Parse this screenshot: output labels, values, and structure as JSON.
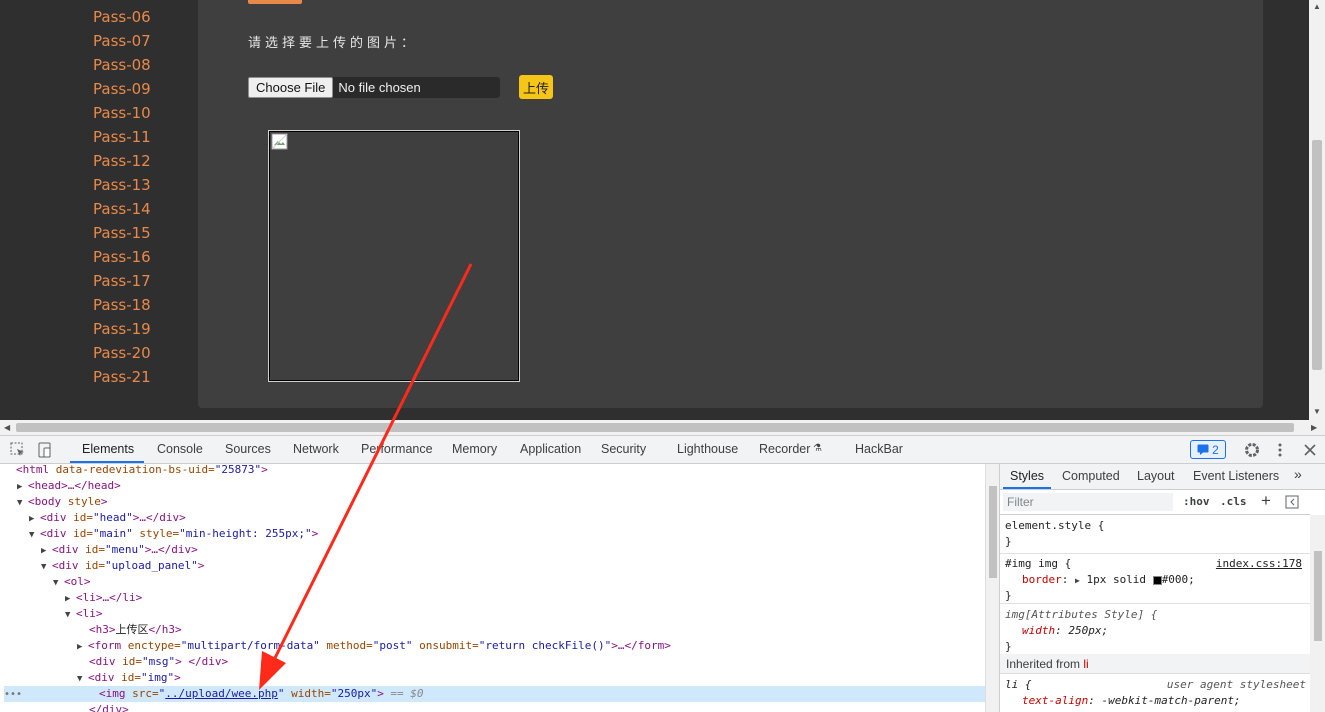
{
  "sidebar": {
    "pass_items": [
      "Pass-06",
      "Pass-07",
      "Pass-08",
      "Pass-09",
      "Pass-10",
      "Pass-11",
      "Pass-12",
      "Pass-13",
      "Pass-14",
      "Pass-15",
      "Pass-16",
      "Pass-17",
      "Pass-18",
      "Pass-19",
      "Pass-20",
      "Pass-21"
    ]
  },
  "upload_panel": {
    "prompt": "请选择要上传的图片：",
    "choose_file_label": "Choose File",
    "no_file_text": "No file chosen",
    "upload_button": "上传"
  },
  "devtools": {
    "tabs": [
      "Elements",
      "Console",
      "Sources",
      "Network",
      "Performance",
      "Memory",
      "Application",
      "Security",
      "Lighthouse",
      "Recorder",
      "HackBar"
    ],
    "active_tab": "Elements",
    "issues_count": "2",
    "dom": {
      "l0_tag": "<html",
      "l0_attr": " data-redeviation-bs-uid=",
      "l0_val": "\"25873\"",
      "l0_end": ">",
      "l1": "<head>…</head>",
      "l2_tag": "<body",
      "l2_attr": " style",
      "l2_end": ">",
      "l3_tag": "<div",
      "l3_attr": " id=",
      "l3_val": "\"head\"",
      "l3_end": ">…</div>",
      "l4_tag": "<div",
      "l4_attr": " id=",
      "l4_val": "\"main\"",
      "l4_attr2": " style=",
      "l4_val2": "\"min-height: 255px;\"",
      "l4_end": ">",
      "l5_tag": "<div",
      "l5_attr": " id=",
      "l5_val": "\"menu\"",
      "l5_end": ">…</div>",
      "l6_tag": "<div",
      "l6_attr": " id=",
      "l6_val": "\"upload_panel\"",
      "l6_end": ">",
      "l7": "<ol>",
      "l8": "<li>…</li>",
      "l9": "<li>",
      "l10_open": "<h3>",
      "l10_text": "上传区",
      "l10_close": "</h3>",
      "l11_tag": "<form",
      "l11_attr": " enctype=",
      "l11_val": "\"multipart/form-data\"",
      "l11_attr2": " method=",
      "l11_val2": "\"post\"",
      "l11_attr3": " onsubmit=",
      "l11_val3": "\"return checkFile()\"",
      "l11_end": ">…</form>",
      "l12_tag": "<div",
      "l12_attr": " id=",
      "l12_val": "\"msg\"",
      "l12_end": "> </div>",
      "l13_tag": "<div",
      "l13_attr": " id=",
      "l13_val": "\"img\"",
      "l13_end": ">",
      "l14_tag": "<img",
      "l14_attr": " src=",
      "l14_val": "../upload/wee.php",
      "l14_attr2": " width=",
      "l14_val2": "\"250px\"",
      "l14_end": ">",
      "l14_eq": " == $0",
      "l15": "</div>"
    },
    "styles": {
      "tabs": [
        "Styles",
        "Computed",
        "Layout",
        "Event Listeners"
      ],
      "filter_placeholder": "Filter",
      "hov": ":hov",
      "cls": ".cls",
      "element_style": "element.style {",
      "close_brace": "}",
      "rule1_selector": "#img img {",
      "rule1_source": "index.css:178",
      "rule1_prop": "border",
      "rule1_value": "1px solid",
      "rule1_color": "#000;",
      "rule2_selector": "img[Attributes Style] {",
      "rule2_prop": "width",
      "rule2_value": "250px;",
      "inherited_label": "Inherited from",
      "inherited_tag": "li",
      "rule3_selector": "li {",
      "rule3_source": "user agent stylesheet",
      "rule3_prop": "text-align",
      "rule3_value": "-webkit-match-parent;"
    }
  },
  "colors": {
    "pass_link": "#e8894a",
    "upload_button": "#f5c518",
    "annotation_arrow": "#ff2a1a",
    "devtools_accent": "#1a73e8"
  }
}
